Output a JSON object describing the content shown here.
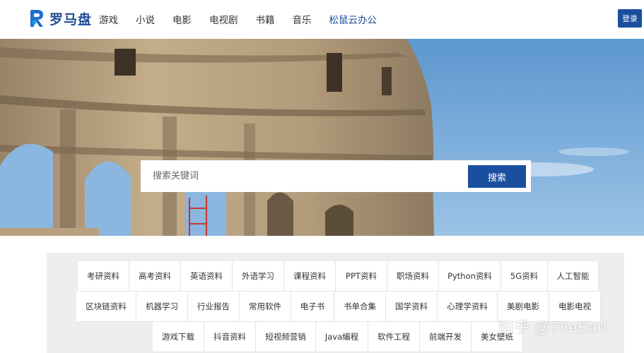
{
  "header": {
    "logo_text": "罗马盘",
    "nav": [
      "游戏",
      "小说",
      "电影",
      "电视剧",
      "书籍",
      "音乐",
      "松鼠云办公"
    ],
    "login_label": "登录"
  },
  "search": {
    "placeholder": "搜索关键词",
    "button_label": "搜索"
  },
  "tags": {
    "rows": [
      [
        "考研资料",
        "高考资料",
        "英语资料",
        "外语学习",
        "课程资料",
        "PPT资料",
        "职场资料",
        "Python资料",
        "5G资料",
        "人工智能"
      ],
      [
        "区块链资料",
        "机器学习",
        "行业报告",
        "常用软件",
        "电子书",
        "书单合集",
        "国学资料",
        "心理学资料",
        "美剧电影",
        "电影电视"
      ],
      [
        "游戏下载",
        "抖音资料",
        "短视频营销",
        "Java编程",
        "软件工程",
        "前端开发",
        "美女壁纸"
      ]
    ]
  },
  "watermark": "知乎 @TheEarl",
  "colors": {
    "brand": "#1a4fa0",
    "logo": "#1e4c96"
  }
}
